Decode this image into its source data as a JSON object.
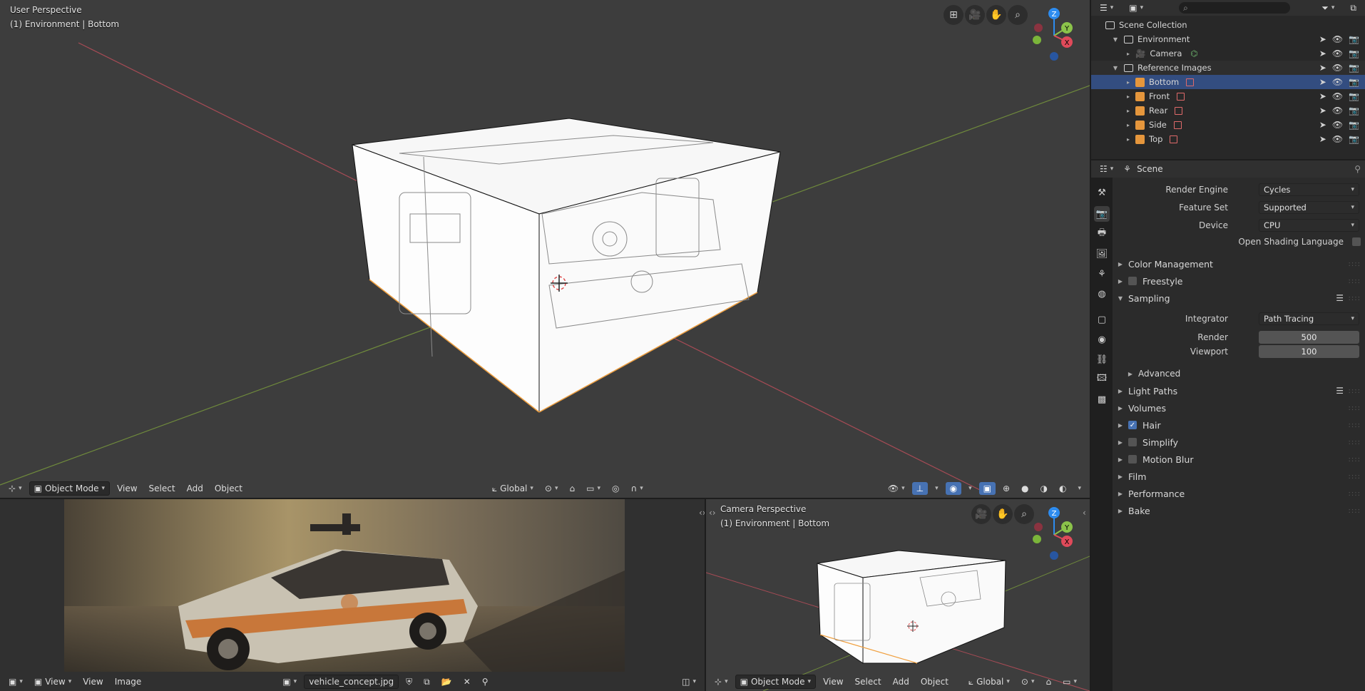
{
  "main_viewport": {
    "view_name": "User Perspective",
    "context": "(1) Environment | Bottom",
    "header": {
      "mode": "Object Mode",
      "menus": [
        "View",
        "Select",
        "Add",
        "Object"
      ],
      "orientation": "Global"
    },
    "gizmo": {
      "z": "Z",
      "y": "Y",
      "x": "X"
    }
  },
  "image_editor": {
    "header": {
      "menus": [
        "View",
        "View",
        "Image"
      ],
      "image_name": "vehicle_concept.jpg"
    }
  },
  "camera_viewport": {
    "view_name": "Camera Perspective",
    "context": "(1) Environment | Bottom",
    "header": {
      "mode": "Object Mode",
      "menus": [
        "View",
        "Select",
        "Add",
        "Object"
      ],
      "orientation": "Global"
    },
    "gizmo": {
      "z": "Z",
      "y": "Y",
      "x": "X"
    }
  },
  "outliner": {
    "root": "Scene Collection",
    "rows": [
      {
        "label": "Environment",
        "kind": "collection",
        "depth": 1,
        "selected": false
      },
      {
        "label": "Camera",
        "kind": "camera",
        "depth": 2,
        "selected": false
      },
      {
        "label": "Reference Images",
        "kind": "collection",
        "depth": 1,
        "selected": false
      },
      {
        "label": "Bottom",
        "kind": "image",
        "depth": 2,
        "selected": true
      },
      {
        "label": "Front",
        "kind": "image",
        "depth": 2,
        "selected": false
      },
      {
        "label": "Rear",
        "kind": "image",
        "depth": 2,
        "selected": false
      },
      {
        "label": "Side",
        "kind": "image",
        "depth": 2,
        "selected": false
      },
      {
        "label": "Top",
        "kind": "image",
        "depth": 2,
        "selected": false
      }
    ]
  },
  "properties": {
    "context": "Scene",
    "render_engine": {
      "label": "Render Engine",
      "value": "Cycles"
    },
    "feature_set": {
      "label": "Feature Set",
      "value": "Supported"
    },
    "device": {
      "label": "Device",
      "value": "CPU"
    },
    "osl": {
      "label": "Open Shading Language",
      "checked": false
    },
    "panels": {
      "color_management": "Color Management",
      "freestyle": "Freestyle",
      "sampling": "Sampling",
      "integrator": {
        "label": "Integrator",
        "value": "Path Tracing"
      },
      "render": {
        "label": "Render",
        "value": "500"
      },
      "viewport": {
        "label": "Viewport",
        "value": "100"
      },
      "advanced": "Advanced",
      "light_paths": "Light Paths",
      "volumes": "Volumes",
      "hair": "Hair",
      "simplify": "Simplify",
      "motion_blur": "Motion Blur",
      "film": "Film",
      "performance": "Performance",
      "bake": "Bake"
    },
    "checks": {
      "freestyle": false,
      "hair": true,
      "simplify": false,
      "motion_blur": false
    }
  },
  "colors": {
    "selection": "#334d80",
    "accent": "#4772b3",
    "object_icon": "#e5963c",
    "x_axis": "#e04a5a",
    "y_axis": "#8bc34a",
    "z_axis": "#2d8cf0"
  }
}
